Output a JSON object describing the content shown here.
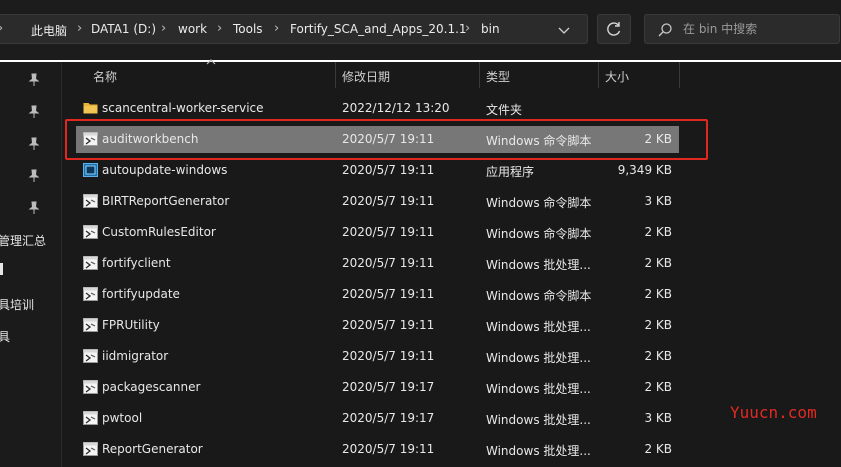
{
  "address_bar": {
    "crumbs": [
      "此电脑",
      "DATA1 (D:)",
      "work",
      "Tools",
      "Fortify_SCA_and_Apps_20.1.1",
      "bin"
    ],
    "dropdown_icon": "chevron-down-icon",
    "refresh_icon": "refresh-icon"
  },
  "search": {
    "placeholder": "在 bin 中搜索",
    "icon": "search-icon"
  },
  "nav": {
    "labels": [
      "管理汇总",
      "",
      "具培训",
      "具"
    ],
    "pin_icon": "pin-icon"
  },
  "columns": {
    "name": "名称",
    "date": "修改日期",
    "type": "类型",
    "size": "大小"
  },
  "files": [
    {
      "name": "scancentral-worker-service",
      "date": "2022/12/12 13:20",
      "type": "文件夹",
      "size": "",
      "icon": "folder-icon"
    },
    {
      "name": "auditworkbench",
      "date": "2020/5/7 19:11",
      "type": "Windows 命令脚本",
      "size": "2 KB",
      "icon": "script-icon",
      "selected": true
    },
    {
      "name": "autoupdate-windows",
      "date": "2020/5/7 19:11",
      "type": "应用程序",
      "size": "9,349 KB",
      "icon": "application-icon"
    },
    {
      "name": "BIRTReportGenerator",
      "date": "2020/5/7 19:11",
      "type": "Windows 命令脚本",
      "size": "3 KB",
      "icon": "script-icon"
    },
    {
      "name": "CustomRulesEditor",
      "date": "2020/5/7 19:11",
      "type": "Windows 命令脚本",
      "size": "2 KB",
      "icon": "script-icon"
    },
    {
      "name": "fortifyclient",
      "date": "2020/5/7 19:11",
      "type": "Windows 批处理...",
      "size": "2 KB",
      "icon": "script-icon"
    },
    {
      "name": "fortifyupdate",
      "date": "2020/5/7 19:11",
      "type": "Windows 命令脚本",
      "size": "2 KB",
      "icon": "script-icon"
    },
    {
      "name": "FPRUtility",
      "date": "2020/5/7 19:11",
      "type": "Windows 批处理...",
      "size": "2 KB",
      "icon": "script-icon"
    },
    {
      "name": "iidmigrator",
      "date": "2020/5/7 19:11",
      "type": "Windows 批处理...",
      "size": "2 KB",
      "icon": "script-icon"
    },
    {
      "name": "packagescanner",
      "date": "2020/5/7 19:17",
      "type": "Windows 批处理...",
      "size": "2 KB",
      "icon": "script-icon"
    },
    {
      "name": "pwtool",
      "date": "2020/5/7 19:17",
      "type": "Windows 批处理...",
      "size": "3 KB",
      "icon": "script-icon"
    },
    {
      "name": "ReportGenerator",
      "date": "2020/5/7 19:11",
      "type": "Windows 批处理...",
      "size": "2 KB",
      "icon": "script-icon"
    }
  ],
  "watermark": "Yuucn.com",
  "colors": {
    "highlight": "#e0281f",
    "selected_row": "#777777",
    "background": "#191919",
    "folder": "#e8b339"
  }
}
